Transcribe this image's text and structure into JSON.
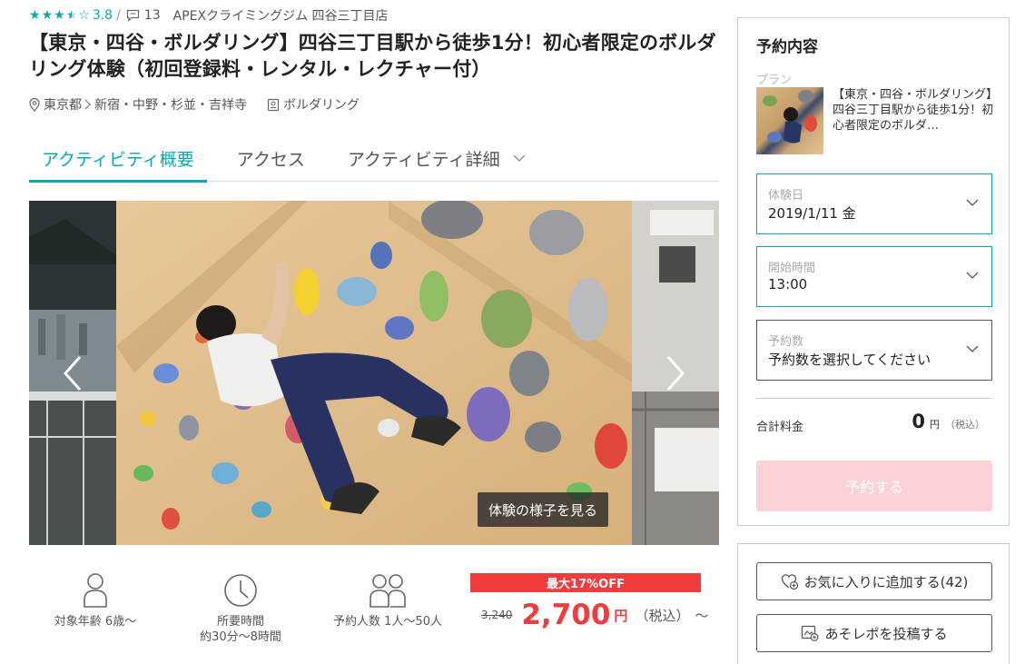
{
  "header": {
    "rating_value": "3.8",
    "rating_stars": 3.5,
    "rating_sep": "/",
    "review_count": "13",
    "shop_name": "APEXクライミングジム 四谷三丁目店"
  },
  "title": "【東京・四谷・ボルダリング】四谷三丁目駅から徒歩1分！初心者限定のボルダリング体験（初回登録料・レンタル・レクチャー付）",
  "location": {
    "region": "東京都",
    "area": "新宿・中野・杉並・吉祥寺",
    "category": "ボルダリング"
  },
  "tabs": [
    {
      "label": "アクティビティ概要",
      "active": true
    },
    {
      "label": "アクセス",
      "active": false
    },
    {
      "label": "アクティビティ詳細",
      "active": false
    }
  ],
  "gallery": {
    "caption_button": "体験の様子を見る"
  },
  "info": {
    "age": "対象年齢 6歳〜",
    "duration_label": "所要時間",
    "duration_value": "約30分〜8時間",
    "participants": "予約人数 1人〜50人"
  },
  "pricing": {
    "discount_label": "最大17%OFF",
    "old_price": "3,240",
    "price": "2,700",
    "currency": "円",
    "tax_note": "（税込）",
    "suffix": "〜"
  },
  "booking": {
    "title": "予約内容",
    "plan_label": "プラン",
    "plan_name": "【東京・四谷・ボルダリング】四谷三丁目駅から徒歩1分！初心者限定のボルダ…",
    "date_label": "体験日",
    "date_value": "2019/1/11 金",
    "time_label": "開始時間",
    "time_value": "13:00",
    "count_label": "予約数",
    "count_placeholder": "予約数を選択してください",
    "total_label": "合計料金",
    "total_value": "0",
    "total_currency": "円",
    "total_tax": "（税込）",
    "book_button": "予約する"
  },
  "actions": {
    "favorite_button": "お気に入りに追加する(42)",
    "report_button": "あそレポを投稿する"
  },
  "colors": {
    "accent": "#0aa6b6",
    "sale_red": "#f03c3c",
    "book_disabled": "#fcd2d6"
  }
}
